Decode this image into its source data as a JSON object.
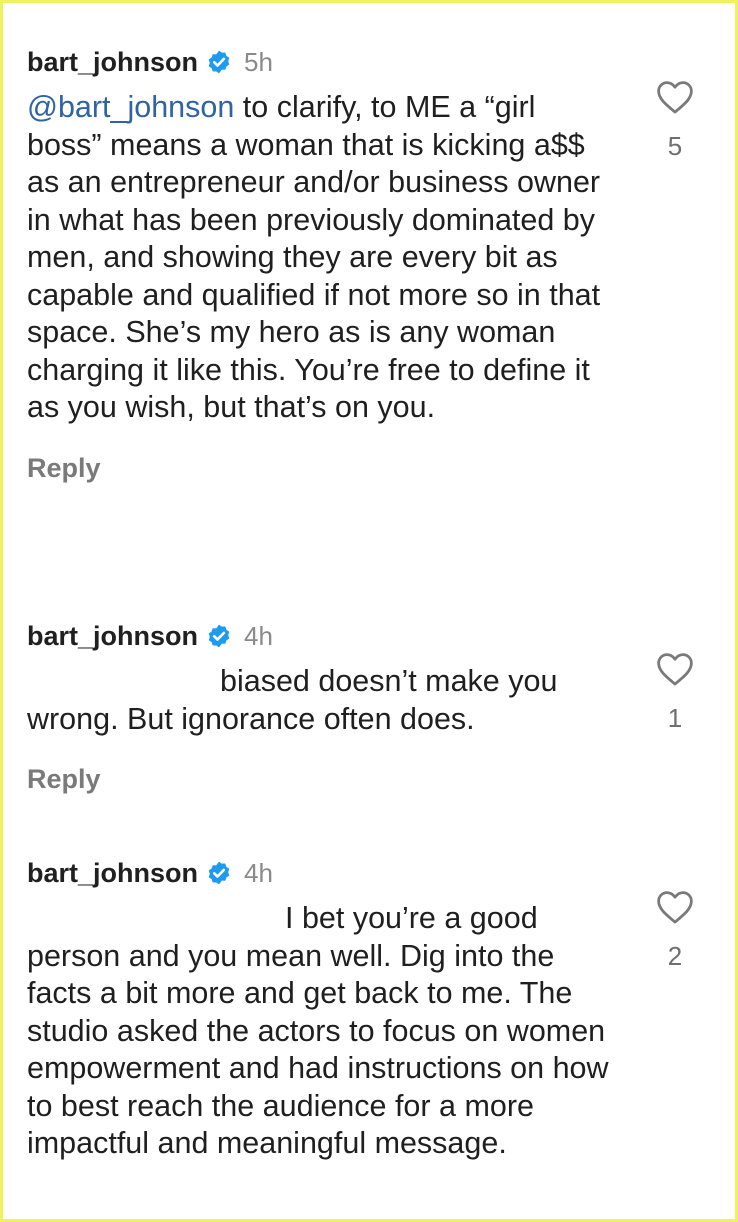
{
  "comments": [
    {
      "username": "bart_johnson",
      "time": "5h",
      "mention": "@bart_johnson",
      "text": " to clarify, to ME a “girl boss” means a woman that is kicking a$$ as an entrepreneur and/or business owner in what has been previously dominated by men, and showing they are every bit as capable and qualified if not more so in that space. She’s my hero as is any woman charging it like this. You’re free to define it as you wish, but that’s on you.",
      "likes": "5",
      "reply_label": "Reply"
    },
    {
      "username": "bart_johnson",
      "time": "4h",
      "text": "biased doesn’t make you wrong. But ignorance often does.",
      "likes": "1",
      "reply_label": "Reply"
    },
    {
      "username": "bart_johnson",
      "time": "4h",
      "text": "I bet you’re a good person and you mean well. Dig into the facts a bit more and get back to me. The studio asked the actors to focus on women empowerment and had instructions on how to best reach the audience for a more impactful and meaningful message.",
      "likes": "2"
    }
  ],
  "colors": {
    "mention": "#2f63a6",
    "verified_badge": "#1d9bf0",
    "frame_border": "#eef25c"
  },
  "icons": {
    "verified": "verified-badge-icon",
    "like": "heart-outline-icon"
  }
}
